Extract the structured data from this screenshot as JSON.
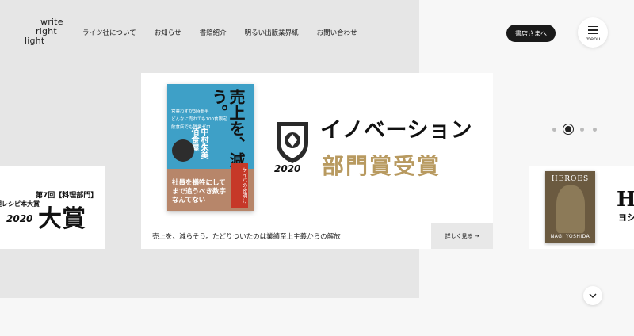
{
  "logo": {
    "line1": "write",
    "line2": "right",
    "line3": "light"
  },
  "nav": {
    "items": [
      "ライツ社について",
      "お知らせ",
      "書籍紹介",
      "明るい出版業界紙",
      "お問い合わせ"
    ]
  },
  "header": {
    "store_button": "書店さまへ",
    "menu_label": "menu"
  },
  "main_slide": {
    "book_title": "売上を、減らそう。",
    "book_subtitle": "社員を犠牲にしてまで追うべき数字なんてない",
    "book_author": "中村朱美",
    "book_shop": "佰食屋",
    "book_bullets": [
      "営業わずか3時間半",
      "どんなに売れても100食限定",
      "飲食店でも残業ゼロ"
    ],
    "book_band": "ケイパの夜明け",
    "award_line1": "イノベーション",
    "award_line2": "部門賞受賞",
    "award_year": "2020",
    "caption": "売上を、減らそう。たどりついたのは業績至上主義からの解放",
    "more_label": "詳しく見る →"
  },
  "left_slide": {
    "line1": "第7回【料理部門】",
    "line2": "料理レシピ本大賞",
    "big": "大賞",
    "year": "2020"
  },
  "right_slide": {
    "book_title": "HEROES",
    "book_author": "NAGI YOSHIDA",
    "big": "H",
    "sub": "ヨシ"
  },
  "carousel": {
    "dot_count": 4,
    "active_index": 1
  }
}
